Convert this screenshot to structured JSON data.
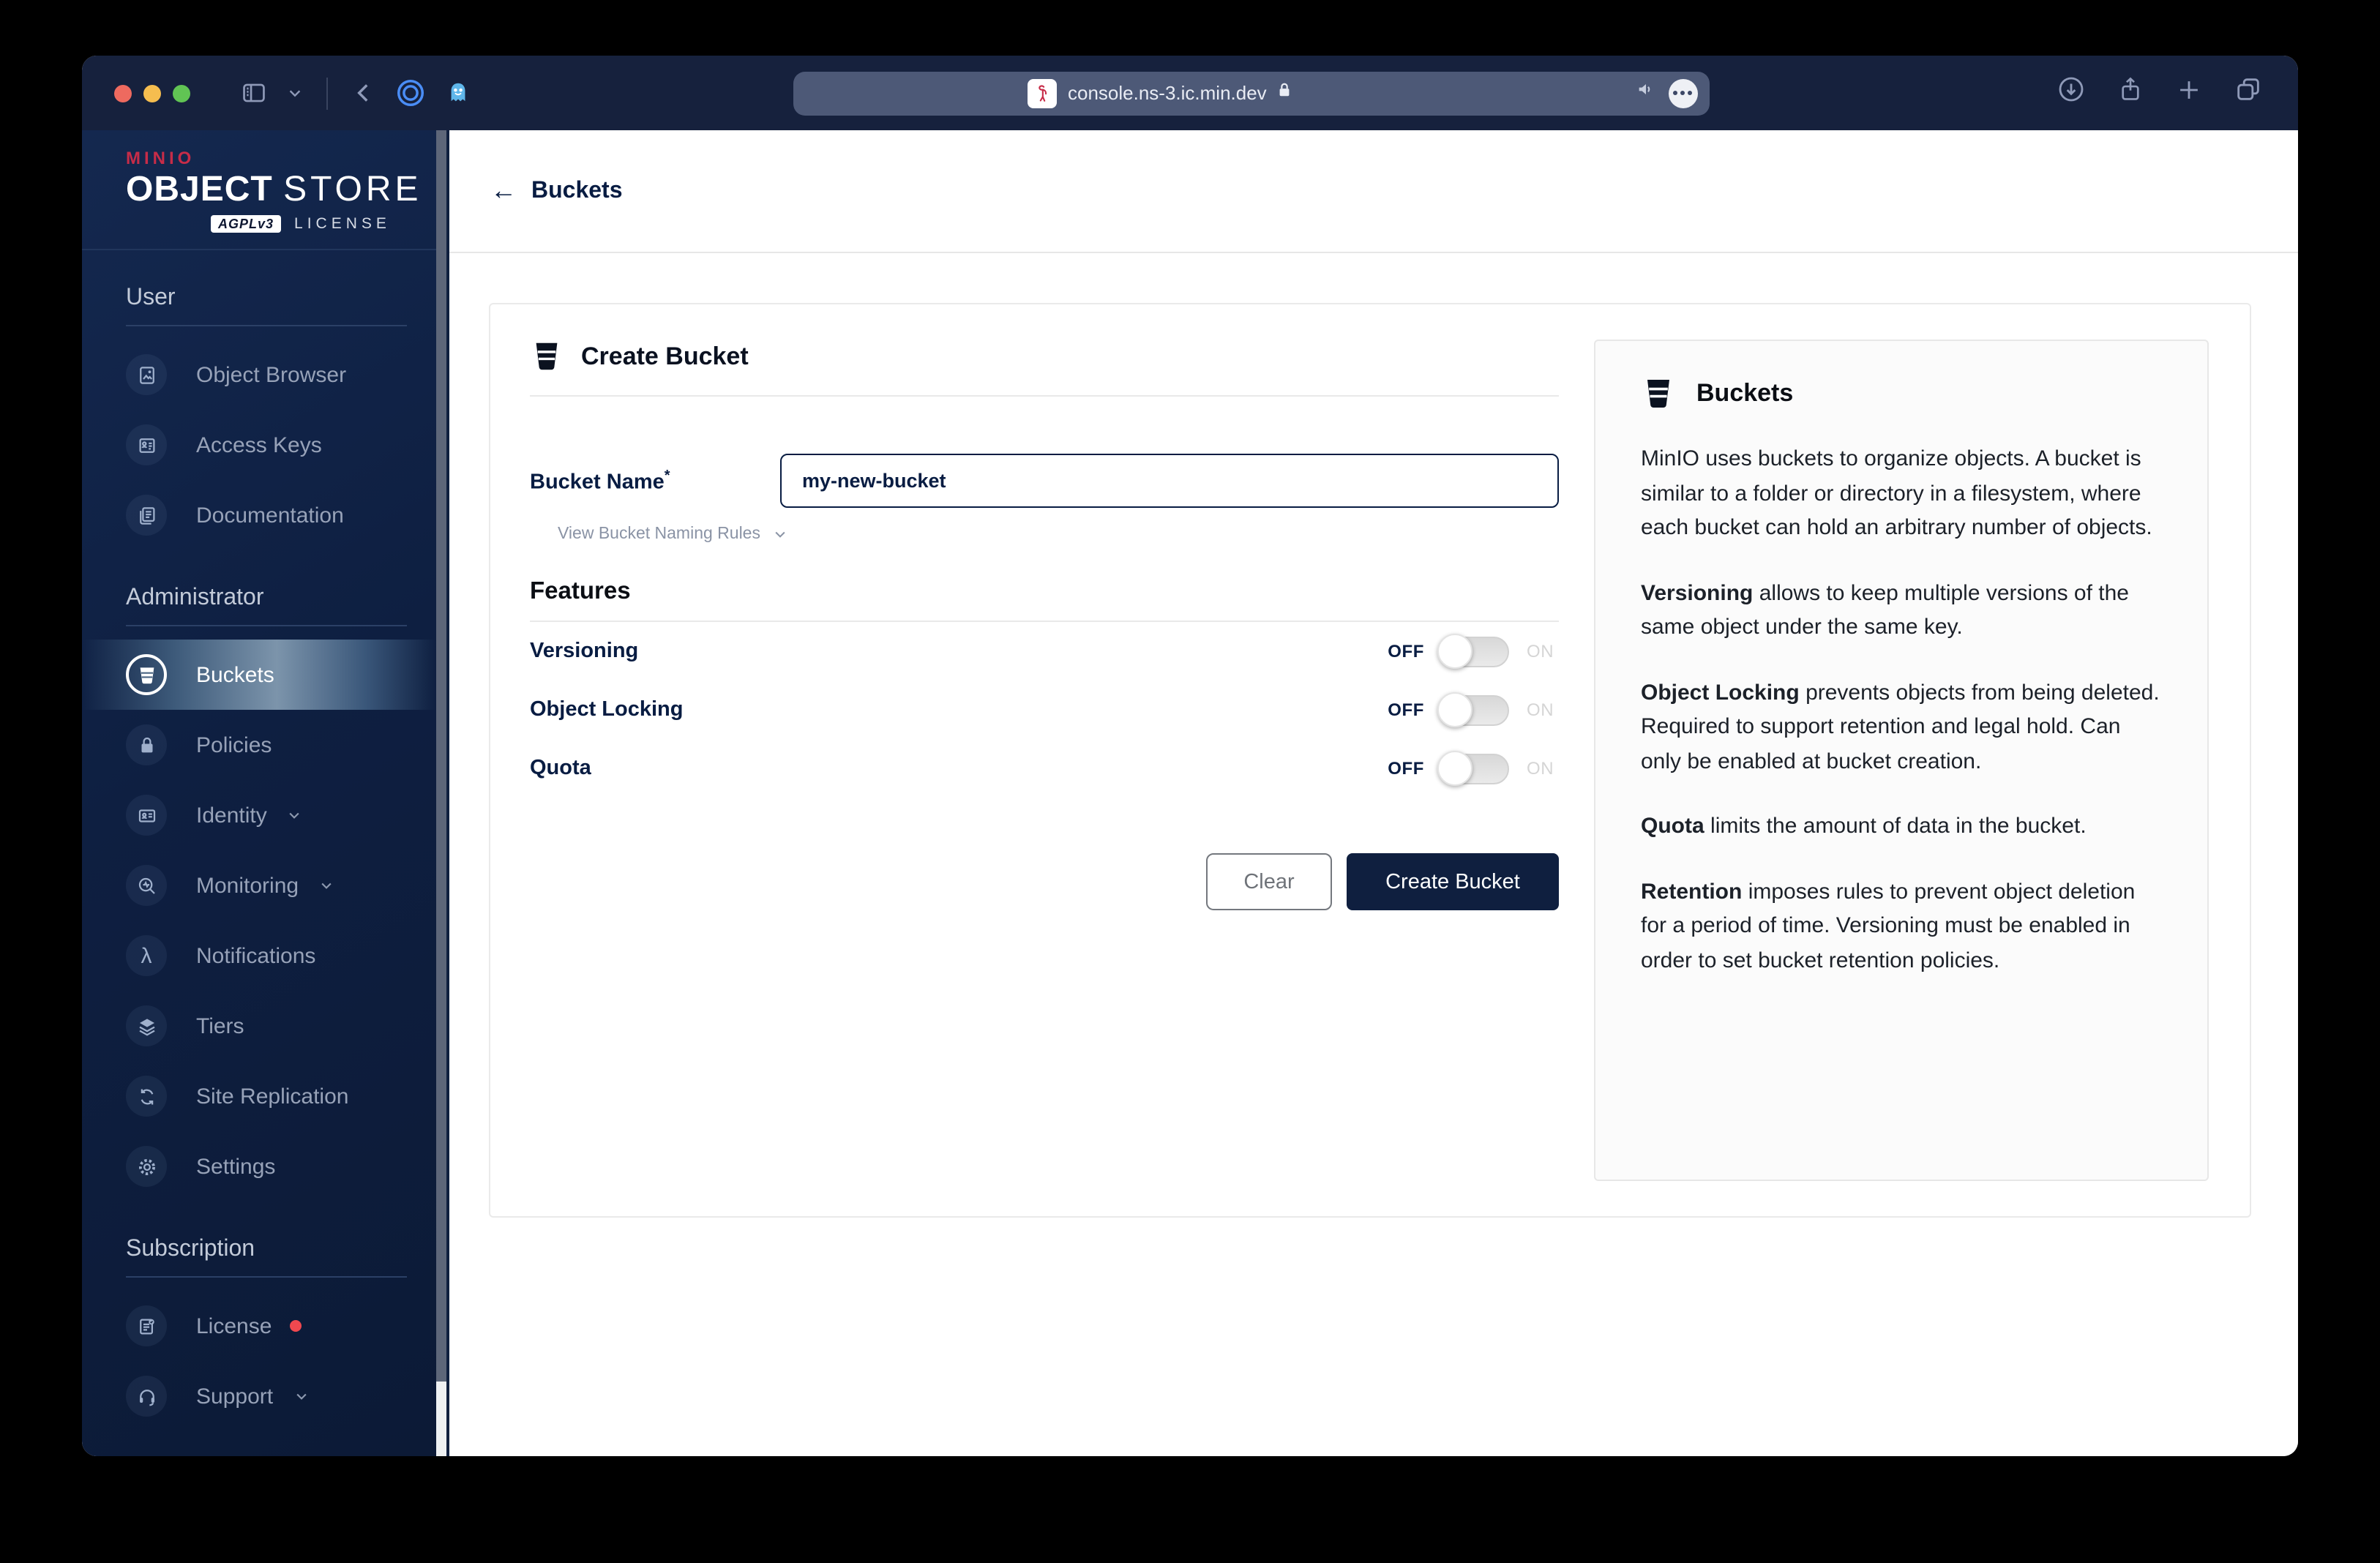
{
  "browser": {
    "url": "console.ns-3.ic.min.dev",
    "window_controls": [
      "close",
      "minimize",
      "zoom"
    ]
  },
  "logo": {
    "brand": "MINIO",
    "title_bold": "OBJECT",
    "title_light": "STORE",
    "badge": "AGPLv3",
    "license": "LICENSE"
  },
  "sidebar": {
    "sections": [
      {
        "label": "User",
        "items": [
          {
            "label": "Object Browser"
          },
          {
            "label": "Access Keys"
          },
          {
            "label": "Documentation"
          }
        ]
      },
      {
        "label": "Administrator",
        "items": [
          {
            "label": "Buckets"
          },
          {
            "label": "Policies"
          },
          {
            "label": "Identity"
          },
          {
            "label": "Monitoring"
          },
          {
            "label": "Notifications"
          },
          {
            "label": "Tiers"
          },
          {
            "label": "Site Replication"
          },
          {
            "label": "Settings"
          }
        ]
      },
      {
        "label": "Subscription",
        "items": [
          {
            "label": "License"
          },
          {
            "label": "Support"
          }
        ]
      }
    ]
  },
  "header": {
    "back_label": "Buckets"
  },
  "form": {
    "title": "Create Bucket",
    "bucket_name_label": "Bucket Name",
    "required_mark": "*",
    "bucket_name_value": "my-new-bucket",
    "naming_rules_label": "View Bucket Naming Rules",
    "features_title": "Features",
    "features": [
      {
        "label": "Versioning",
        "state": "OFF"
      },
      {
        "label": "Object Locking",
        "state": "OFF"
      },
      {
        "label": "Quota",
        "state": "OFF"
      }
    ],
    "off_label": "OFF",
    "on_label": "ON",
    "clear_label": "Clear",
    "submit_label": "Create Bucket"
  },
  "info_panel": {
    "title": "Buckets",
    "paragraphs": [
      {
        "lead": "",
        "text": "MinIO uses buckets to organize objects. A bucket is similar to a folder or directory in a filesystem, where each bucket can hold an arbitrary number of objects."
      },
      {
        "lead": "Versioning",
        "text": "allows to keep multiple versions of the same object under the same key."
      },
      {
        "lead": "Object Locking",
        "text": "prevents objects from being deleted. Required to support retention and legal hold. Can only be enabled at bucket creation."
      },
      {
        "lead": "Quota",
        "text": "limits the amount of data in the bucket."
      },
      {
        "lead": "Retention",
        "text": "imposes rules to prevent object deletion for a period of time. Versioning must be enabled in order to set bucket retention policies."
      }
    ]
  },
  "colors": {
    "navy": "#081C42",
    "titlebar": "#16213d",
    "brand_red": "#C72C48",
    "badge_red": "#F0484F",
    "primary_button": "#0F1F3F",
    "sidebar_top": "#14284F",
    "sidebar_bottom": "#0C1A36"
  }
}
